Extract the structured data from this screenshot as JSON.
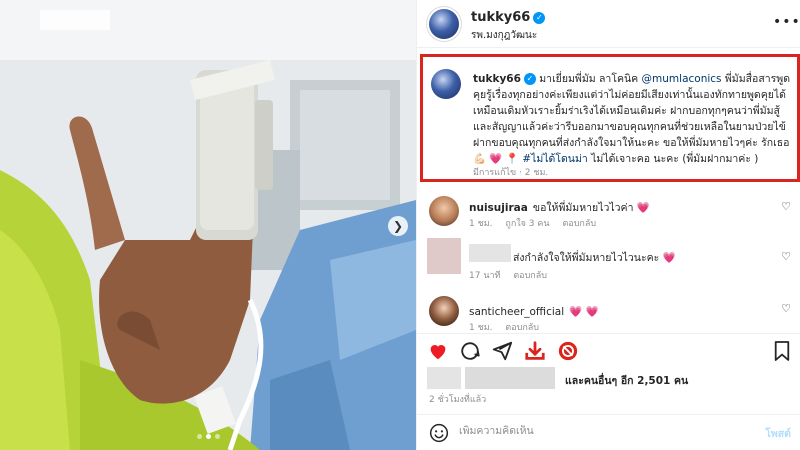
{
  "post": {
    "username": "tukky66",
    "location": "รพ.มงกุฎวัฒนะ"
  },
  "caption": {
    "username": "tukky66",
    "text_1": "มาเยี่ยมพี่มัม ลาโคนิค",
    "mention": "@mumlaconics",
    "text_2": "พี่มัมสื่อสารพูดคุยรู้เรื่องทุกอย่างค่ะเพียงแต่ว่าไม่ค่อยมีเสียงเท่านั้นเองทักทายพูดคุยได้เหมือนเดิมหัวเราะยิ้มร่าเริงได้เหมือนเดิมค่ะ ฝากบอกทุกๆคนว่าพี่มัมสู้และสัญญาแล้วค่ะว่ารีบออกมาขอบคุณทุกคนที่ช่วยเหลือในยามป่วยไข้ ฝากขอบคุณทุกคนที่ส่งกำลังใจมาให้นะคะ ขอให้พี่มัมหายไวๆค่ะ รักเธอ 💪🏻 💗 📍",
    "hashtag": "#ไม่ได้โดนม่า",
    "text_3": "ไม่ได้เจาะคอ นะคะ (พี่มัมฝากมาค่ะ )",
    "edited": "มีการแก้ไข",
    "time": "2 ชม."
  },
  "comments": [
    {
      "username": "nuisujiraa",
      "text": "ขอให้พี่มัมหายไวไวค่า 💗",
      "time": "1 ชม.",
      "likes": "ถูกใจ 3 คน",
      "reply": "ตอบกลับ"
    },
    {
      "username": "",
      "text": "ส่งกำลังใจให้พี่มัมหายไวไวนะคะ 💗",
      "time": "17 นาที",
      "reply": "ตอบกลับ"
    },
    {
      "username": "santicheer_official",
      "text": "💗 💗",
      "time": "1 ชม.",
      "reply": "ตอบกลับ"
    }
  ],
  "likes": {
    "text": "และคนอื่นๆ อีก 2,501 คน"
  },
  "timestamp": "2 ชั่วโมงที่แล้ว",
  "add_comment": {
    "placeholder": "เพิ่มความคิดเห็น",
    "post_label": "โพสต์"
  },
  "icons": {
    "carousel_next": "chevron-right-icon",
    "more": "more-horizontal-icon",
    "like": "heart-filled-icon",
    "comment": "comment-icon",
    "share": "share-icon",
    "download": "download-icon",
    "repost": "repost-icon",
    "save": "bookmark-icon",
    "emoji": "emoji-icon"
  },
  "colors": {
    "highlight_border": "#d9251d",
    "like_red": "#ed1c24",
    "link": "#00376b",
    "verified": "#0095f6"
  },
  "carousel": {
    "total": 3,
    "current": 2
  }
}
